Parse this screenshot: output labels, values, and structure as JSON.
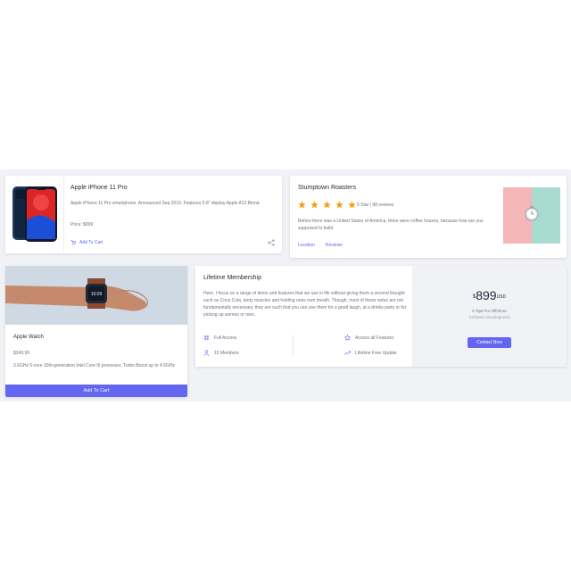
{
  "iphone_card": {
    "title": "Apple iPhone 11 Pro",
    "description": "Apple iPhone 11 Pro smartphone. Announced Sep 2019. Features 5.8″ display Apple A13 Bionic",
    "price": "Price: $899",
    "add_to_cart": "Add To Cart",
    "icons": {
      "cart": "cart-icon",
      "share": "share-icon"
    }
  },
  "roasters_card": {
    "title": "Stumptown Roasters",
    "stars": 5,
    "rating_text": "5 Star | 98 reviews",
    "description": "Before there was a United States of America, there were coffee houses, because how are you supposed to build.",
    "links": [
      "Location",
      "Reviews"
    ],
    "star_color": "#f59e0b"
  },
  "watch_card": {
    "title": "Apple Watch",
    "price": "$249.99",
    "description": "3.6GHz 6-core 10th-generation Intel Core i5 processor, Turbo Boost up to 4.5GHz",
    "add_to_cart": "Add To Cart"
  },
  "membership_card": {
    "title": "Lifetime Membership",
    "description": "Here, I focus on a range of items and features that we use in life without giving them a second thought such as Coca Cola, body muscles and holding ones own breath. Though, most of these notes are not fundamentally necessary, they are such that you can use them for a good laugh, at a drinks party or for picking up women or men.",
    "features": [
      {
        "label": "Full Access",
        "icon": "grid-icon"
      },
      {
        "label": "Access all Features",
        "icon": "star-outline-icon"
      },
      {
        "label": "15 Members",
        "icon": "user-icon"
      },
      {
        "label": "Lifetime Free Update",
        "icon": "trending-up-icon"
      }
    ],
    "price_currency": "$",
    "price_amount": "899",
    "price_unit": "USD",
    "tagline": "5 Tips For Offshore",
    "tagline2": "Software Development",
    "contact_button": "Contact Now"
  },
  "colors": {
    "accent": "#6366f1",
    "band_background": "#f1f2f6"
  }
}
